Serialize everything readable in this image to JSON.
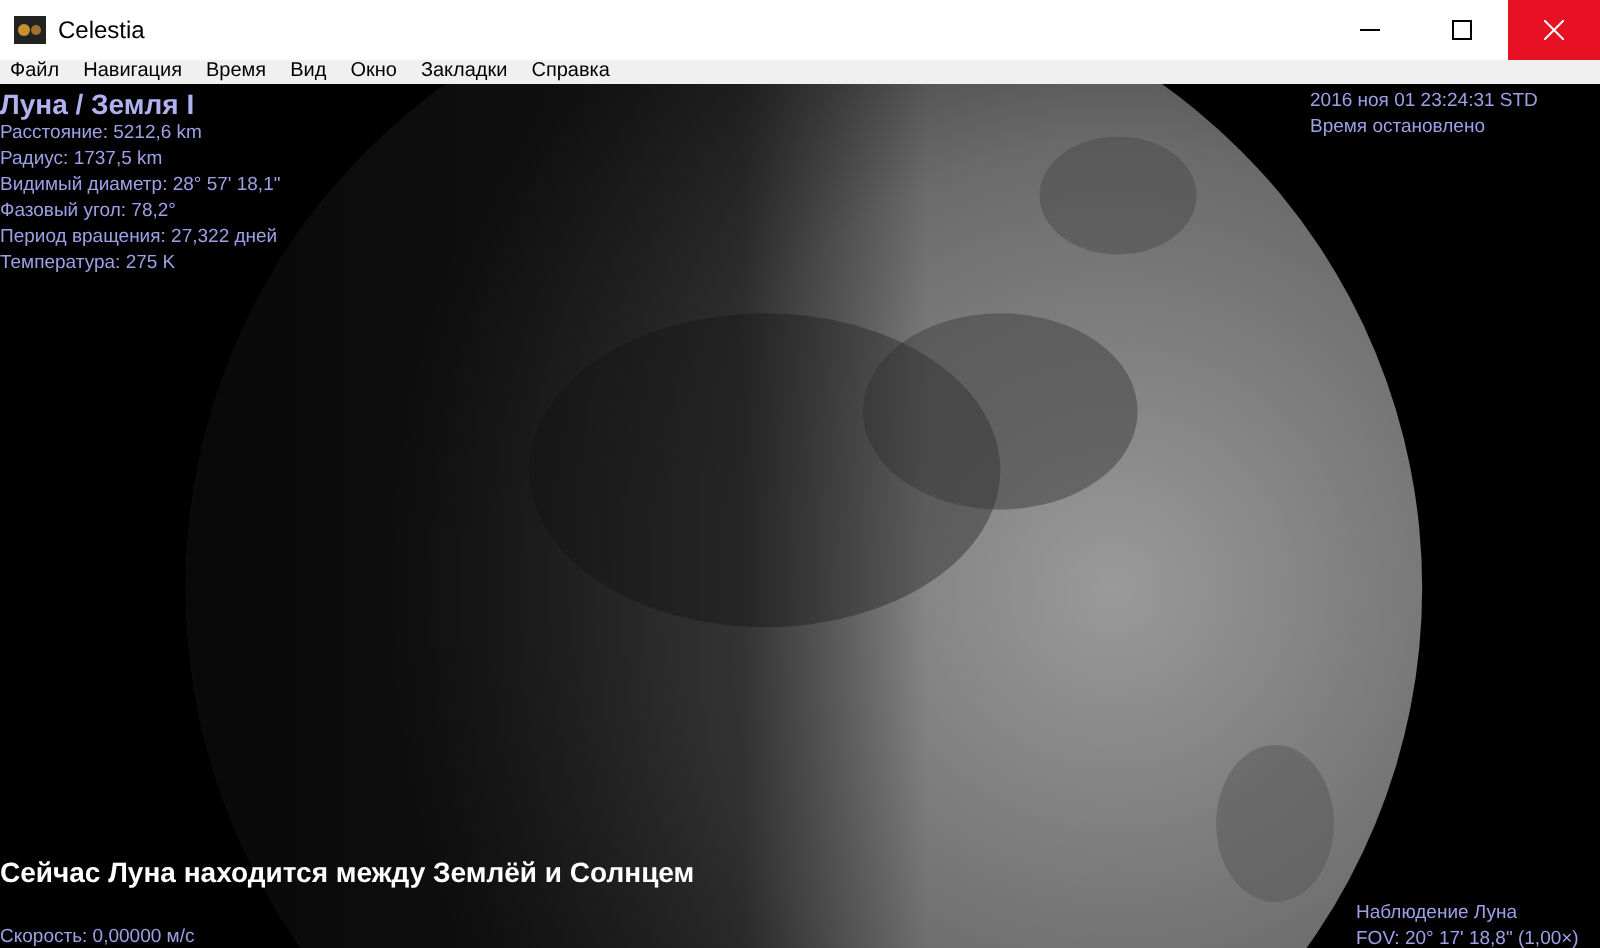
{
  "window": {
    "title": "Celestia"
  },
  "menu": [
    {
      "label": "Файл"
    },
    {
      "label": "Навигация"
    },
    {
      "label": "Время"
    },
    {
      "label": "Вид"
    },
    {
      "label": "Окно"
    },
    {
      "label": "Закладки"
    },
    {
      "label": "Справка"
    }
  ],
  "object_info": {
    "name": "Луна / Земля I",
    "lines": [
      "Расстояние: 5212,6 km",
      "Радиус: 1737,5 km",
      "Видимый диаметр: 28° 57' 18,1\"",
      "Фазовый угол: 78,2°",
      "Период вращения: 27,322 дней",
      "Температура: 275 K"
    ]
  },
  "time_info": {
    "date": "2016 ноя 01 23:24:31 STD",
    "status": "Время остановлено"
  },
  "message": "Сейчас Луна находится между Землёй и Солнцем",
  "speed": "Скорость: 0,00000 м/с",
  "view_info": {
    "mode": "Наблюдение Луна",
    "fov": "FOV: 20° 17' 18,8\" (1,00×)"
  }
}
